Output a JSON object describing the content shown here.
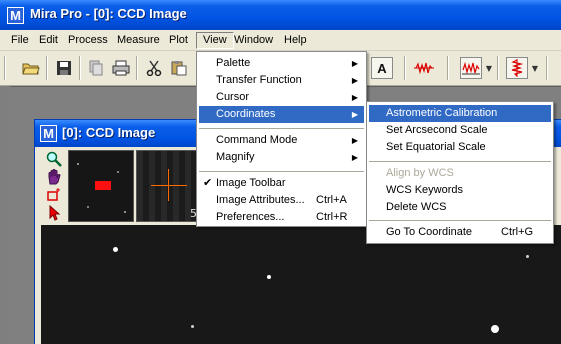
{
  "window": {
    "title": "Mira Pro - [0]: CCD Image",
    "app_icon_letter": "M"
  },
  "menubar": {
    "items": [
      "File",
      "Edit",
      "Process",
      "Measure",
      "Plot",
      "View",
      "Window",
      "Help"
    ],
    "active": "View"
  },
  "toolbar": {
    "icons": [
      "open-folder-icon",
      "save-disk-icon",
      "copy-icon",
      "print-icon",
      "cut-icon",
      "paste-icon",
      "text-tool-icon",
      "row-plot-icon",
      "column-plot-icon",
      "vertical-plot-icon"
    ],
    "text_tool_glyph": "A"
  },
  "child_window": {
    "title": "[0]: CCD Image",
    "thumbnail_label": "5"
  },
  "view_menu": {
    "items": [
      {
        "label": "Palette",
        "submenu": true
      },
      {
        "label": "Transfer Function",
        "submenu": true
      },
      {
        "label": "Cursor",
        "submenu": true
      },
      {
        "label": "Coordinates",
        "submenu": true,
        "highlighted": true
      },
      {
        "label": "Command Mode",
        "submenu": true
      },
      {
        "label": "Magnify",
        "submenu": true
      },
      {
        "label": "Image Toolbar",
        "checked": true
      },
      {
        "label": "Image Attributes...",
        "shortcut": "Ctrl+A"
      },
      {
        "label": "Preferences...",
        "shortcut": "Ctrl+R"
      }
    ]
  },
  "coordinates_submenu": {
    "items": [
      {
        "label": "Astrometric Calibration",
        "highlighted": true
      },
      {
        "label": "Set Arcsecond Scale"
      },
      {
        "label": "Set Equatorial Scale"
      },
      {
        "label": "Align by WCS",
        "disabled": true
      },
      {
        "label": "WCS Keywords"
      },
      {
        "label": "Delete WCS"
      },
      {
        "label": "Go To Coordinate",
        "shortcut": "Ctrl+G"
      }
    ]
  },
  "colors": {
    "titlebar": "#0054e3",
    "highlight": "#316ac5",
    "menu_bg": "#ece9d8"
  }
}
